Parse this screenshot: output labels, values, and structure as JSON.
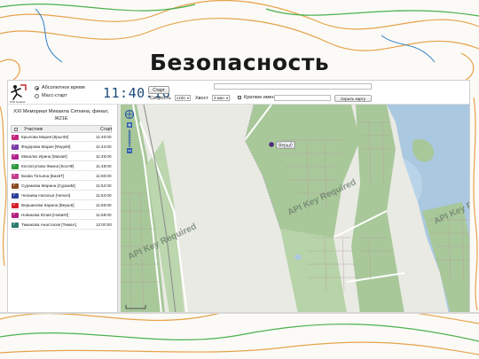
{
  "slide": {
    "title": "Безопасность"
  },
  "toolbar": {
    "logo_subtitle": "SFR Gotland",
    "time_mode_absolute": "Абсолютное время",
    "time_mode_mass_start": "Масс-старт",
    "clock": "11:40:16",
    "start_button": "Старт",
    "speed_label": "Скорость",
    "speed_value": "x100",
    "tail_label": "Хвост",
    "tail_value": "3 мин",
    "short_names_label": "Краткие имена",
    "hide_map_button": "Скрыть карту"
  },
  "event": {
    "title": "XXI Мемориал Михаила Сяткина, финал, Ж21Е"
  },
  "table": {
    "col_participant": "Участник",
    "col_start": "Старт",
    "rows": [
      {
        "name": "Крылова Мария [КрылМ]",
        "start": "11:40:00",
        "color": "#c3257a"
      },
      {
        "name": "Федорова Мария [ФедоМ]",
        "start": "11:44:00",
        "color": "#7a3aa8"
      },
      {
        "name": "Михалко Ирина [МихаИ]",
        "start": "11:46:00",
        "color": "#b0228a"
      },
      {
        "name": "Коспатулова Фаина [КоспФ]",
        "start": "11:48:00",
        "color": "#2f9a3a"
      },
      {
        "name": "Бахва Татьяна [БахвТ]",
        "start": "11:50:00",
        "color": "#c43b8c"
      },
      {
        "name": "Сурамова Марина [СурамМ]",
        "start": "11:52:00",
        "color": "#8a4a20"
      },
      {
        "name": "Чепаева Наталья [ЧепаН]",
        "start": "11:54:00",
        "color": "#2b3f9a"
      },
      {
        "name": "Вершинова Карина [ВершК]",
        "start": "11:56:00",
        "color": "#d8202a"
      },
      {
        "name": "Новикова Юлия [НовиЮ]",
        "start": "11:58:00",
        "color": "#b02080"
      },
      {
        "name": "Тимакова Анастасия [ТимаА]",
        "start": "12:00:00",
        "color": "#2b7a6a"
      }
    ]
  },
  "map": {
    "watermark_text": "API Key Required",
    "runner_label": "Верш0",
    "colors": {
      "forest": "#a8c89a",
      "open": "#e9eae4",
      "water": "#aac8e0",
      "road": "#ffffff",
      "runner": "#4b2a7a"
    }
  }
}
